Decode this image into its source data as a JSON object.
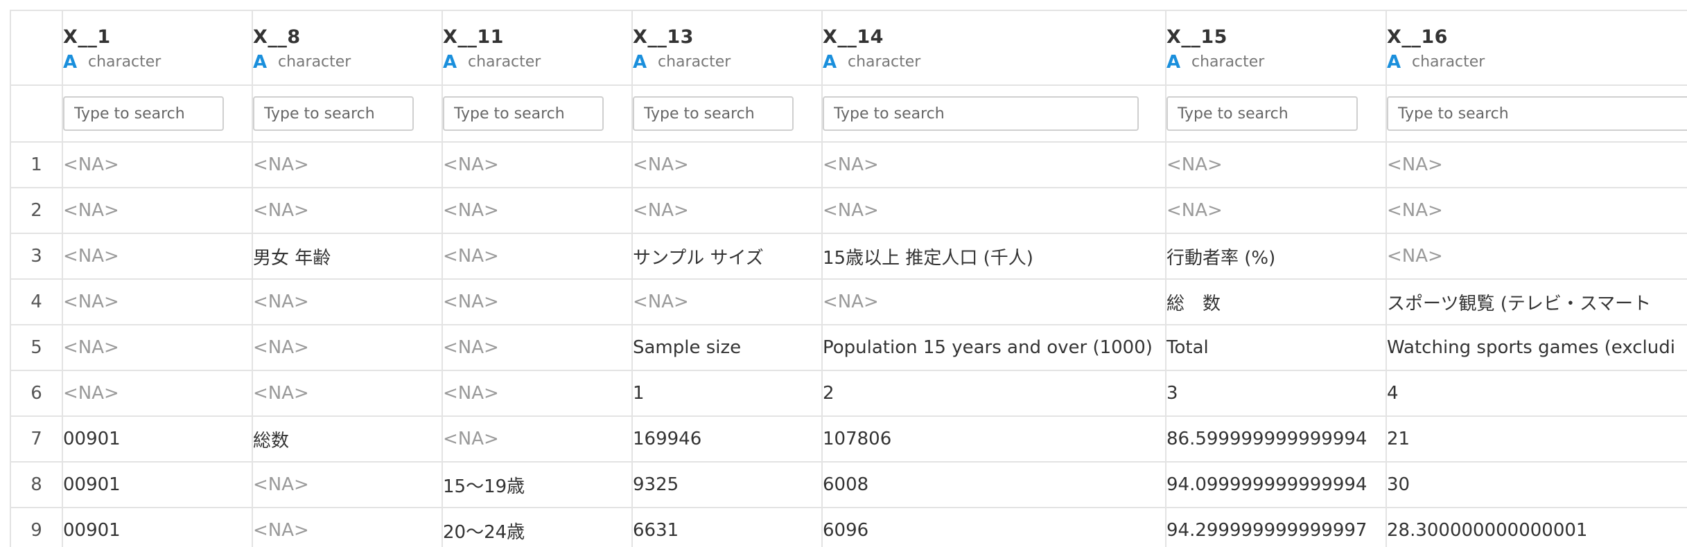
{
  "columns": [
    {
      "name": "X__1",
      "type": "character",
      "placeholder": "Type to search"
    },
    {
      "name": "X__8",
      "type": "character",
      "placeholder": "Type to search"
    },
    {
      "name": "X__11",
      "type": "character",
      "placeholder": "Type to search"
    },
    {
      "name": "X__13",
      "type": "character",
      "placeholder": "Type to search"
    },
    {
      "name": "X__14",
      "type": "character",
      "placeholder": "Type to search"
    },
    {
      "name": "X__15",
      "type": "character",
      "placeholder": "Type to search"
    },
    {
      "name": "X__16",
      "type": "character",
      "placeholder": "Type to search"
    }
  ],
  "type_icon_glyph": "A",
  "na_label": "<NA>",
  "rows": [
    {
      "num": "1",
      "cells": [
        null,
        null,
        null,
        null,
        null,
        null,
        null
      ]
    },
    {
      "num": "2",
      "cells": [
        null,
        null,
        null,
        null,
        null,
        null,
        null
      ]
    },
    {
      "num": "3",
      "cells": [
        null,
        "男女 年齢",
        null,
        "サンプル サイズ",
        "15歳以上 推定人口 (千人)",
        "行動者率 (%)",
        null
      ]
    },
    {
      "num": "4",
      "cells": [
        null,
        null,
        null,
        null,
        null,
        "総　数",
        "スポーツ観覧 (テレビ・スマート"
      ]
    },
    {
      "num": "5",
      "cells": [
        null,
        null,
        null,
        "Sample size",
        "Population 15 years and over (1000)",
        "Total",
        "Watching sports games (excludi"
      ]
    },
    {
      "num": "6",
      "cells": [
        null,
        null,
        null,
        "1",
        "2",
        "3",
        "4"
      ]
    },
    {
      "num": "7",
      "cells": [
        "00901",
        "総数",
        null,
        "169946",
        "107806",
        "86.599999999999994",
        "21"
      ]
    },
    {
      "num": "8",
      "cells": [
        "00901",
        null,
        "15〜19歳",
        "9325",
        "6008",
        "94.099999999999994",
        "30"
      ]
    },
    {
      "num": "9",
      "cells": [
        "00901",
        null,
        "20〜24歳",
        "6631",
        "6096",
        "94.299999999999997",
        "28.300000000000001"
      ]
    }
  ],
  "colors": {
    "type_icon": "#1a8fdc",
    "na_text": "#9a9a9a",
    "border": "#e3e3e3"
  }
}
